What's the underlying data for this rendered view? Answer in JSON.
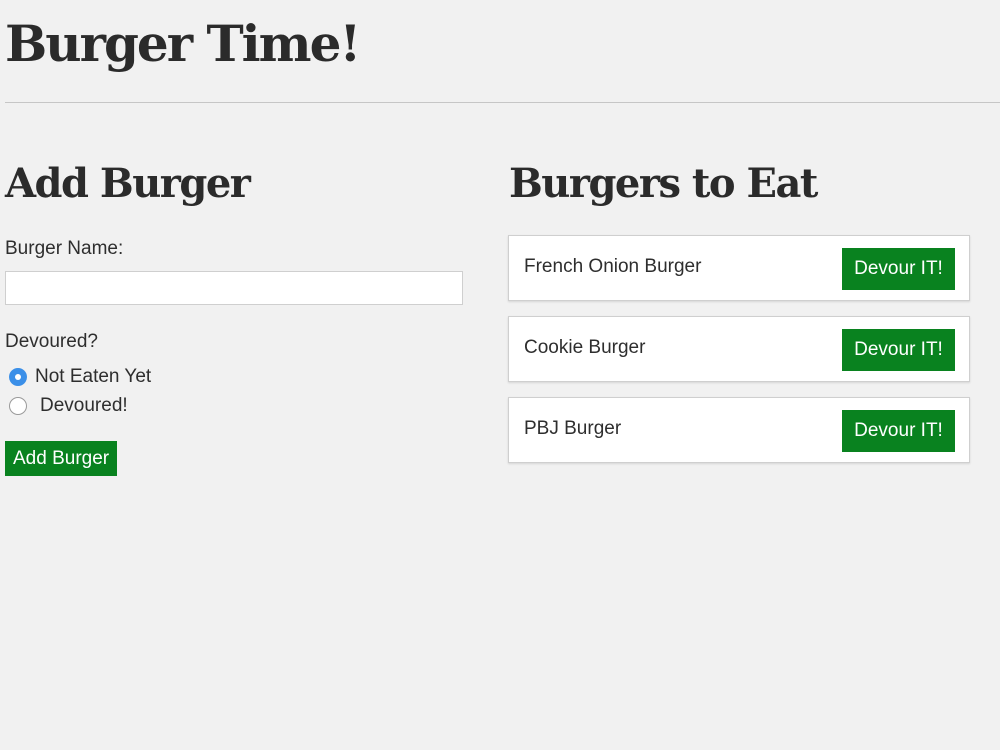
{
  "header": {
    "title": "Burger Time!"
  },
  "add_section": {
    "heading": "Add Burger",
    "name_label": "Burger Name:",
    "name_value": "",
    "name_placeholder": "",
    "devoured_label": "Devoured?",
    "options": [
      {
        "label": "Not Eaten Yet",
        "checked": true
      },
      {
        "label": "Devoured!",
        "checked": false
      }
    ],
    "submit_label": "Add Burger"
  },
  "eat_section": {
    "heading": "Burgers to Eat",
    "burgers": [
      {
        "name": "French Onion Burger",
        "button_label": "Devour IT!"
      },
      {
        "name": "Cookie Burger",
        "button_label": "Devour IT!"
      },
      {
        "name": "PBJ Burger",
        "button_label": "Devour IT!"
      }
    ]
  },
  "colors": {
    "background": "#f1f1f1",
    "button_green": "#09821f",
    "radio_accent": "#3b8fe8",
    "text": "#2e2e2e"
  }
}
